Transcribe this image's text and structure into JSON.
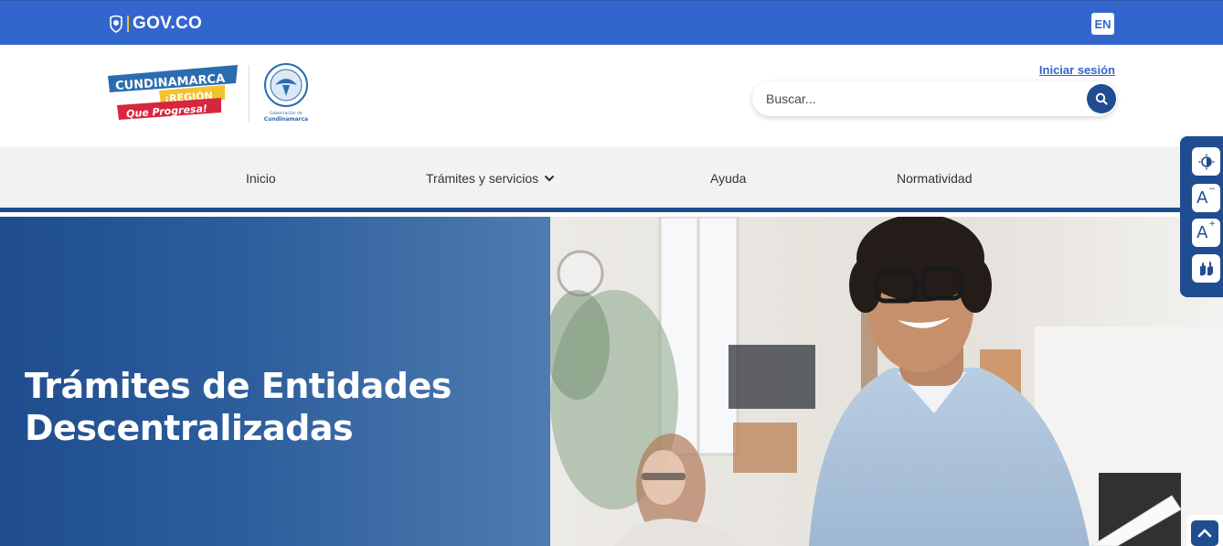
{
  "gov_bar": {
    "logo_text": "GOV.CO",
    "language_button": "EN",
    "color": "#3366cc"
  },
  "header": {
    "brand_logo_lines": [
      "CUNDINAMARCA",
      "¡REGIÓN",
      "Que Progresa!"
    ],
    "seal_caption": [
      "Gobernación de",
      "Cundinamarca"
    ],
    "login_link": "Iniciar sesión",
    "search": {
      "placeholder": "Buscar..."
    }
  },
  "nav": {
    "items": [
      {
        "label": "Inicio"
      },
      {
        "label": "Trámites y servicios",
        "has_dropdown": true
      },
      {
        "label": "Ayuda"
      },
      {
        "label": "Normatividad"
      }
    ]
  },
  "hero": {
    "title_line1": "Trámites de Entidades",
    "title_line2": "Descentralizadas",
    "image": "smiling-man-with-glasses-in-office-photo"
  },
  "accessibility_bar": {
    "buttons": [
      {
        "icon": "contrast-icon",
        "label": ""
      },
      {
        "icon": "decrease-font-icon",
        "label": "A",
        "mark": "−"
      },
      {
        "icon": "increase-font-icon",
        "label": "A",
        "mark": "+"
      },
      {
        "icon": "sign-language-icon",
        "label": ""
      }
    ]
  },
  "back_to_top": {
    "icon": "chevron-up-icon"
  },
  "colors": {
    "primary": "#1f4d8f",
    "gov_blue": "#3366cc",
    "nav_bg": "#f2f2f2"
  }
}
